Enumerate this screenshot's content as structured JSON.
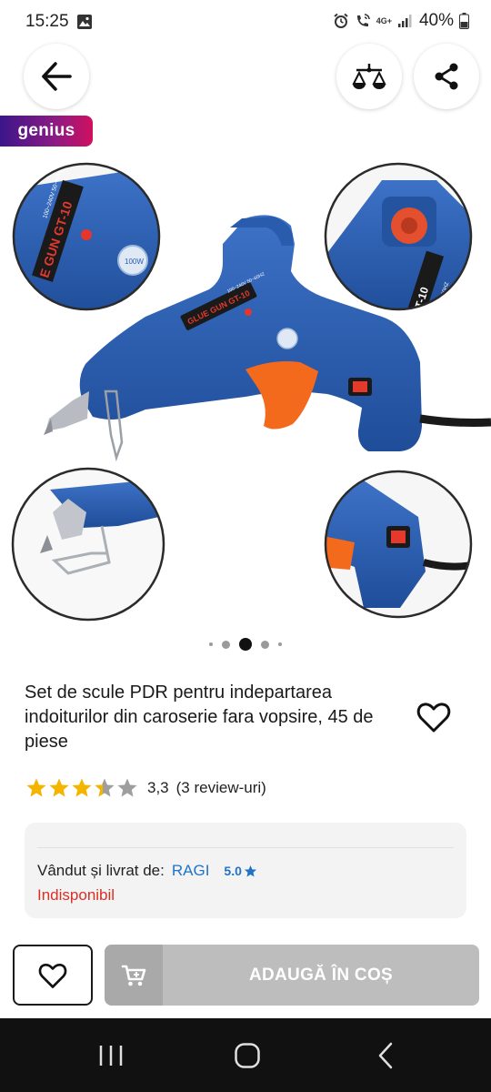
{
  "status_bar": {
    "time": "15:25",
    "battery": "40%",
    "network": "4G+",
    "icons": [
      "gallery-icon",
      "alarm-icon",
      "wifi-calling-icon",
      "signal-icon",
      "battery-icon"
    ]
  },
  "header": {
    "back_icon": "arrow-left-icon",
    "compare_icon": "balance-scale-icon",
    "share_icon": "share-icon"
  },
  "badge": {
    "label": "genius"
  },
  "gallery": {
    "image_count": 5,
    "active_index": 2,
    "main_image": "glue-gun-product-photo",
    "main_labels": [
      "GLUE GUN GT-10",
      "100~240V 50~60HZ"
    ],
    "detail_labels": [
      "E GUN GT-10",
      "100~240V 50~60HZ",
      "GT-10",
      "100~240V 50~60HZ"
    ],
    "seal_text": "100W"
  },
  "product": {
    "title": "Set de scule PDR pentru indepartarea indoiturilor din caroserie fara vopsire, 45 de piese",
    "rating_value": "3,3",
    "rating_stars": 3.3,
    "review_count": "(3 review-uri)"
  },
  "seller": {
    "label": "Vândut și livrat de:",
    "name": "RAGI",
    "score": "5.0",
    "availability": "Indisponibil"
  },
  "actions": {
    "add_to_cart": "ADAUGĂ ÎN COȘ",
    "wishlist_icon": "heart-icon",
    "cart_icon": "cart-icon"
  },
  "colors": {
    "accent_blue": "#1f73c9",
    "unavailable_red": "#d93025",
    "genius_gradient_start": "#3b168a",
    "genius_gradient_end": "#d0105f",
    "star_gold": "#f5b400",
    "cart_disabled": "#bdbdbd"
  },
  "nav_bar": {
    "icons": [
      "recent-apps-icon",
      "home-icon",
      "back-nav-icon"
    ]
  }
}
